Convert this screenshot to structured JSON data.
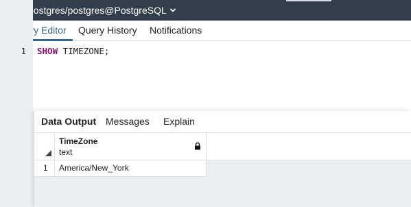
{
  "connection": {
    "label": "postgres/postgres@PostgreSQL",
    "icon": "connection-plug-icon",
    "chevron_icon": "chevron-down-icon"
  },
  "tabs": [
    {
      "label": "Query Editor",
      "active": true
    },
    {
      "label": "Query History",
      "active": false
    },
    {
      "label": "Notifications",
      "active": false
    }
  ],
  "editor": {
    "line_number": "1",
    "keyword": "SHOW",
    "rest": " TIMEZONE;"
  },
  "result_tabs": [
    {
      "label": "Data Output",
      "active": true
    },
    {
      "label": "Messages",
      "active": false
    },
    {
      "label": "Explain",
      "active": false
    }
  ],
  "grid": {
    "columns": [
      {
        "name": "TimeZone",
        "type": "text",
        "icon": "lock-icon"
      }
    ],
    "rows": [
      {
        "row_number": "1",
        "cells": [
          "America/New_York"
        ]
      }
    ]
  },
  "colors": {
    "header_bg": "#333e4c",
    "accent": "#326690",
    "keyword": "#8b0f6a",
    "panel_bg": "#ebeef3"
  }
}
